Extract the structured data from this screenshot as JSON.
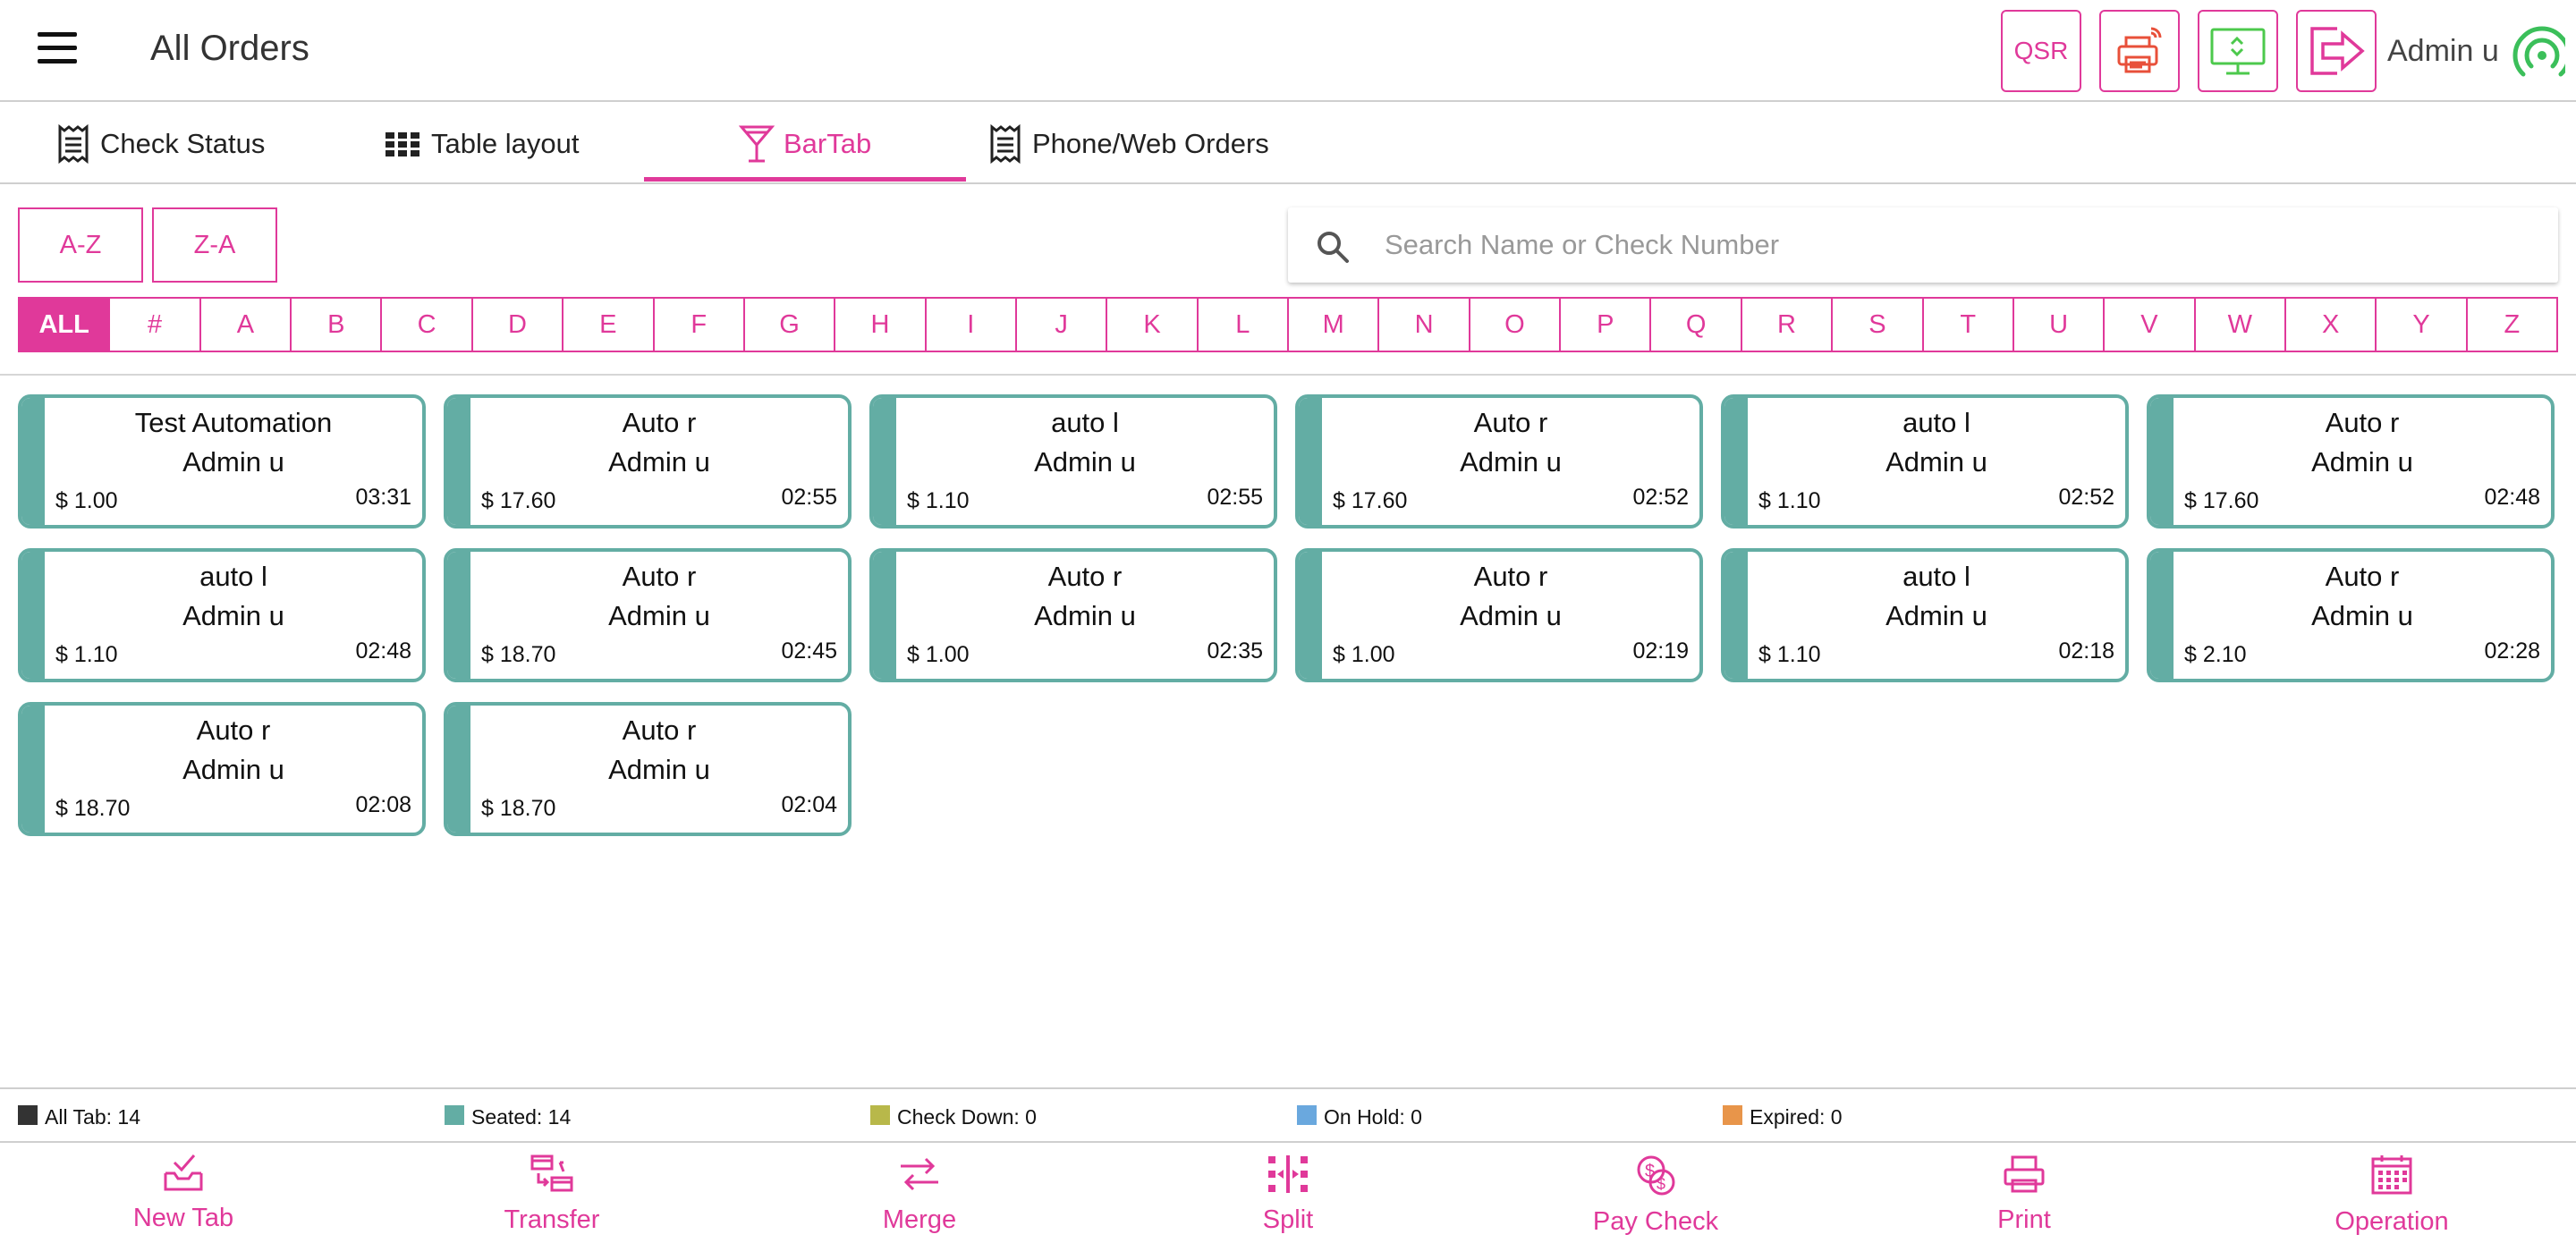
{
  "header": {
    "title": "All Orders",
    "qsr_label": "QSR",
    "user_name": "Admin u"
  },
  "tabs": [
    {
      "label": "Check Status",
      "icon": "receipt-icon"
    },
    {
      "label": "Table layout",
      "icon": "grid-icon"
    },
    {
      "label": "BarTab",
      "icon": "cocktail-icon",
      "active": true
    },
    {
      "label": "Phone/Web Orders",
      "icon": "receipt-icon"
    }
  ],
  "sort": {
    "az": "A-Z",
    "za": "Z-A"
  },
  "search": {
    "placeholder": "Search Name or Check Number",
    "value": ""
  },
  "alphabet": [
    "ALL",
    "#",
    "A",
    "B",
    "C",
    "D",
    "E",
    "F",
    "G",
    "H",
    "I",
    "J",
    "K",
    "L",
    "M",
    "N",
    "O",
    "P",
    "Q",
    "R",
    "S",
    "T",
    "U",
    "V",
    "W",
    "X",
    "Y",
    "Z"
  ],
  "alphabet_active": "ALL",
  "tabs_list": [
    {
      "name": "Test Automation",
      "server": "Admin u",
      "amount": "$ 1.00",
      "time": "03:31"
    },
    {
      "name": "Auto r",
      "server": "Admin u",
      "amount": "$ 17.60",
      "time": "02:55"
    },
    {
      "name": "auto l",
      "server": "Admin u",
      "amount": "$ 1.10",
      "time": "02:55"
    },
    {
      "name": "Auto r",
      "server": "Admin u",
      "amount": "$ 17.60",
      "time": "02:52"
    },
    {
      "name": "auto l",
      "server": "Admin u",
      "amount": "$ 1.10",
      "time": "02:52"
    },
    {
      "name": "Auto r",
      "server": "Admin u",
      "amount": "$ 17.60",
      "time": "02:48"
    },
    {
      "name": "auto l",
      "server": "Admin u",
      "amount": "$ 1.10",
      "time": "02:48"
    },
    {
      "name": "Auto r",
      "server": "Admin u",
      "amount": "$ 18.70",
      "time": "02:45"
    },
    {
      "name": "Auto r",
      "server": "Admin u",
      "amount": "$ 1.00",
      "time": "02:35"
    },
    {
      "name": "Auto r",
      "server": "Admin u",
      "amount": "$ 1.00",
      "time": "02:19"
    },
    {
      "name": "auto l",
      "server": "Admin u",
      "amount": "$ 1.10",
      "time": "02:18"
    },
    {
      "name": "Auto r",
      "server": "Admin u",
      "amount": "$ 2.10",
      "time": "02:28"
    },
    {
      "name": "Auto r",
      "server": "Admin u",
      "amount": "$ 18.70",
      "time": "02:08"
    },
    {
      "name": "Auto r",
      "server": "Admin u",
      "amount": "$ 18.70",
      "time": "02:04"
    }
  ],
  "legend": [
    {
      "label": "All Tab: 14",
      "color": "#333333"
    },
    {
      "label": "Seated: 14",
      "color": "#63ada4"
    },
    {
      "label": "Check Down: 0",
      "color": "#b8b84a"
    },
    {
      "label": "On Hold: 0",
      "color": "#6aa8de"
    },
    {
      "label": "Expired: 0",
      "color": "#e8954a"
    }
  ],
  "toolbar": [
    {
      "label": "New Tab",
      "icon": "new-tab-icon"
    },
    {
      "label": "Transfer",
      "icon": "transfer-icon"
    },
    {
      "label": "Merge",
      "icon": "merge-icon"
    },
    {
      "label": "Split",
      "icon": "split-icon"
    },
    {
      "label": "Pay Check",
      "icon": "pay-check-icon"
    },
    {
      "label": "Print",
      "icon": "print-icon"
    },
    {
      "label": "Operation",
      "icon": "calendar-icon"
    }
  ],
  "colors": {
    "accent": "#e0399a",
    "seated": "#63ada4",
    "printer": "#e8503a",
    "screen": "#4cc94c",
    "wifi": "#3bbf5a"
  }
}
